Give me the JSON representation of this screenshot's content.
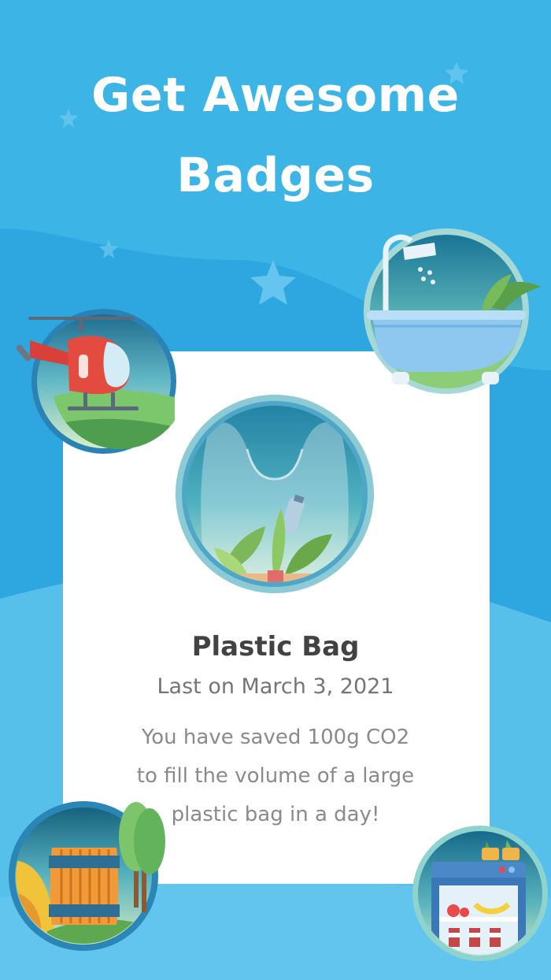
{
  "screen": {
    "headline_line1": "Get Awesome",
    "headline_line2": "Badges",
    "background_color": "#2ea6e0"
  },
  "featured_badge": {
    "title": "Plastic Bag",
    "date": "Last on March 3, 2021",
    "description": [
      "You have saved 100g CO2",
      "to fill the volume of a large",
      "plastic bag in a day!"
    ],
    "icon": "plastic-bag-icon"
  },
  "decorative_badges": [
    {
      "icon": "helicopter-icon"
    },
    {
      "icon": "bathtub-icon"
    },
    {
      "icon": "barrel-icon"
    },
    {
      "icon": "refrigerator-icon"
    }
  ]
}
